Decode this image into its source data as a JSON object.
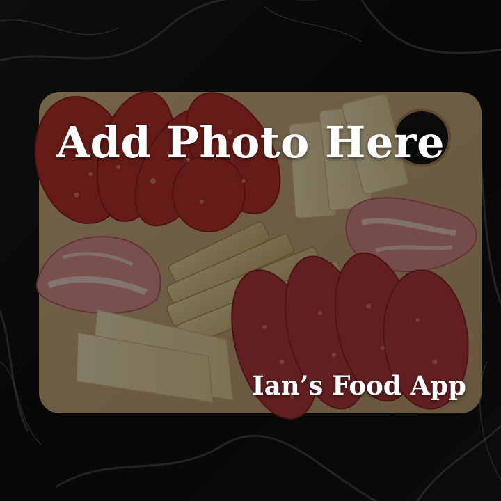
{
  "placeholder": {
    "title": "Add Photo Here"
  },
  "branding": {
    "app_name": "Ian’s Food App"
  },
  "colors": {
    "text": "#ffffff",
    "dim_overlay": "#000000"
  }
}
